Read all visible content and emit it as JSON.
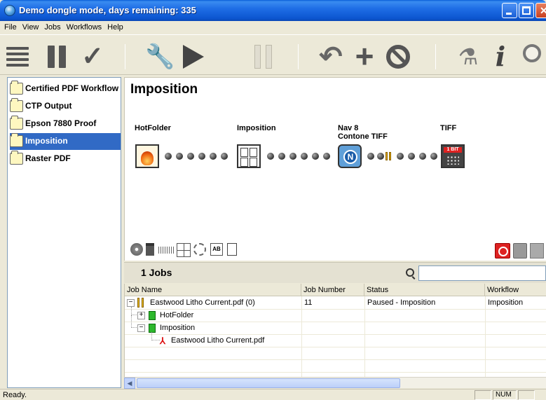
{
  "window": {
    "title": "Demo dongle mode, days remaining: 335"
  },
  "menu": [
    "File",
    "View",
    "Jobs",
    "Workflows",
    "Help"
  ],
  "toolbar_icons": [
    "list-icon",
    "pause-icon",
    "check-icon",
    "wrench-icon",
    "play-icon",
    "pause-disabled-icon",
    "undo-icon",
    "plus-icon",
    "stop-icon",
    "flask-icon",
    "info-icon",
    "search-icon"
  ],
  "workflows": [
    {
      "label": "Certified PDF Workflow",
      "selected": false
    },
    {
      "label": "CTP Output",
      "selected": false
    },
    {
      "label": "Epson 7880 Proof",
      "selected": false
    },
    {
      "label": "Imposition",
      "selected": true
    },
    {
      "label": "Raster PDF",
      "selected": false
    }
  ],
  "workflow_panel": {
    "title": "Imposition",
    "nodes": [
      {
        "label": "HotFolder",
        "icon": "hotfolder-icon"
      },
      {
        "label": "Imposition",
        "icon": "imposition-icon"
      },
      {
        "label": "Nav 8\nContone TIFF",
        "icon": "nav-icon"
      },
      {
        "label": "TIFF",
        "icon": "tiff-1bit-icon"
      }
    ],
    "tiff_badge": "1 BIT",
    "nav_glyph": "N",
    "tool_ab": "AB"
  },
  "jobs": {
    "count_label": "1 Jobs",
    "search_value": "",
    "columns": [
      "Job Name",
      "Job Number",
      "Status",
      "Workflow"
    ],
    "rows": [
      {
        "expander": "−",
        "name": "Eastwood Litho Current.pdf (0)",
        "number": "11",
        "status": "Paused - Imposition",
        "workflow": "Imposition"
      },
      {
        "expander": "+",
        "name": "HotFolder",
        "number": "",
        "status": "",
        "workflow": ""
      },
      {
        "expander": "−",
        "name": "Imposition",
        "number": "",
        "status": "",
        "workflow": ""
      },
      {
        "expander": "",
        "name": "Eastwood Litho Current.pdf",
        "number": "",
        "status": "",
        "workflow": ""
      }
    ]
  },
  "status": {
    "text": "Ready.",
    "num": "NUM"
  }
}
